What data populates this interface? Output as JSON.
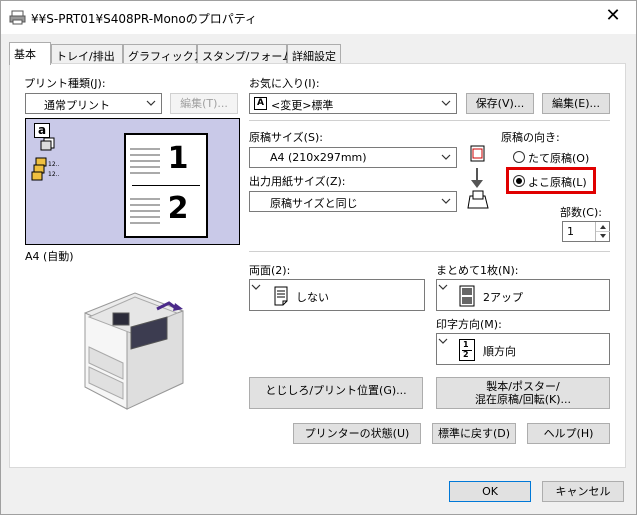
{
  "window": {
    "title": "¥¥S-PRT01¥S408PR-Monoのプロパティ",
    "close_glyph": "✕"
  },
  "tabs": [
    {
      "label": "基本",
      "active": true
    },
    {
      "label": "トレイ/排出",
      "active": false
    },
    {
      "label": "グラフィックス",
      "active": false
    },
    {
      "label": "スタンプ/フォーム",
      "active": false
    },
    {
      "label": "詳細設定",
      "active": false
    }
  ],
  "print_type": {
    "label": "プリント種類(J):",
    "value": "通常プリント",
    "edit_button": "編集(T)..."
  },
  "favorites": {
    "label": "お気に入り(I):",
    "icon_letter": "A",
    "value": "<変更>標準",
    "save_button": "保存(V)...",
    "edit_button": "編集(E)..."
  },
  "preview": {
    "page1": "1",
    "page2": "2",
    "caption": "A4 (自動)",
    "icon_letter": "a",
    "icon_small_a": "12..",
    "icon_small_b": "12.."
  },
  "document_size": {
    "label": "原稿サイズ(S):",
    "value": "A4 (210x297mm)"
  },
  "output_size": {
    "label": "出力用紙サイズ(Z):",
    "value": "原稿サイズと同じ"
  },
  "orientation": {
    "label": "原稿の向き:",
    "portrait": "たて原稿(O)",
    "landscape": "よこ原稿(L)",
    "selected": "landscape",
    "highlight_color": "#e00000"
  },
  "copies": {
    "label": "部数(C):",
    "value": "1"
  },
  "duplex": {
    "label": "両面(2):",
    "value": "しない"
  },
  "nup": {
    "label": "まとめて1枚(N):",
    "value": "2アップ"
  },
  "print_direction": {
    "label": "印字方向(M):",
    "value": "順方向",
    "icon_top": "1",
    "icon_bottom": "2"
  },
  "buttons": {
    "binding": "とじしろ/プリント位置(G)...",
    "booklet_line1": "製本/ポスター/",
    "booklet_line2": "混在原稿/回転(K)...",
    "printer_status": "プリンターの状態(U)",
    "defaults": "標準に戻す(D)",
    "help": "ヘルプ(H)",
    "ok": "OK",
    "cancel": "キャンセル"
  }
}
